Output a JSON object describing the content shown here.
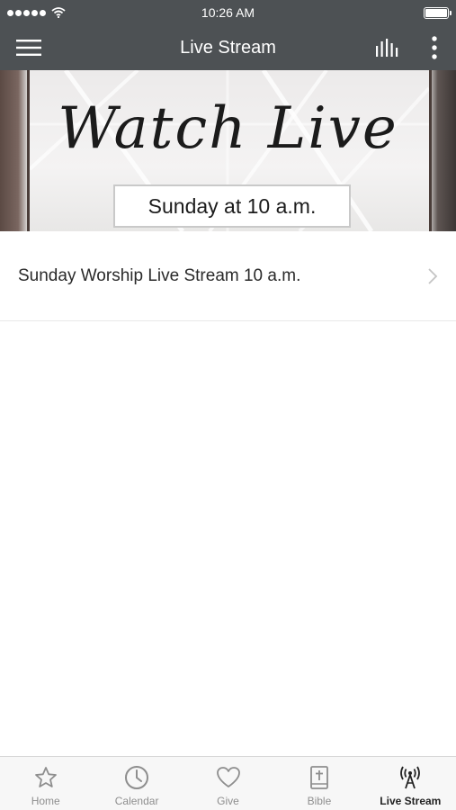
{
  "status_bar": {
    "time": "10:26 AM"
  },
  "nav": {
    "title": "Live Stream"
  },
  "banner": {
    "script_text": "Watch Live",
    "box_text": "Sunday at 10 a.m."
  },
  "list": {
    "items": [
      {
        "label": "Sunday Worship Live Stream 10 a.m."
      }
    ]
  },
  "tabs": [
    {
      "label": "Home",
      "icon": "star-icon",
      "active": false
    },
    {
      "label": "Calendar",
      "icon": "clock-icon",
      "active": false
    },
    {
      "label": "Give",
      "icon": "heart-icon",
      "active": false
    },
    {
      "label": "Bible",
      "icon": "bible-icon",
      "active": false
    },
    {
      "label": "Live Stream",
      "icon": "broadcast-icon",
      "active": true
    }
  ],
  "colors": {
    "header": "#4d5154",
    "tab_inactive": "#8e8e8e",
    "tab_active": "#222222"
  }
}
